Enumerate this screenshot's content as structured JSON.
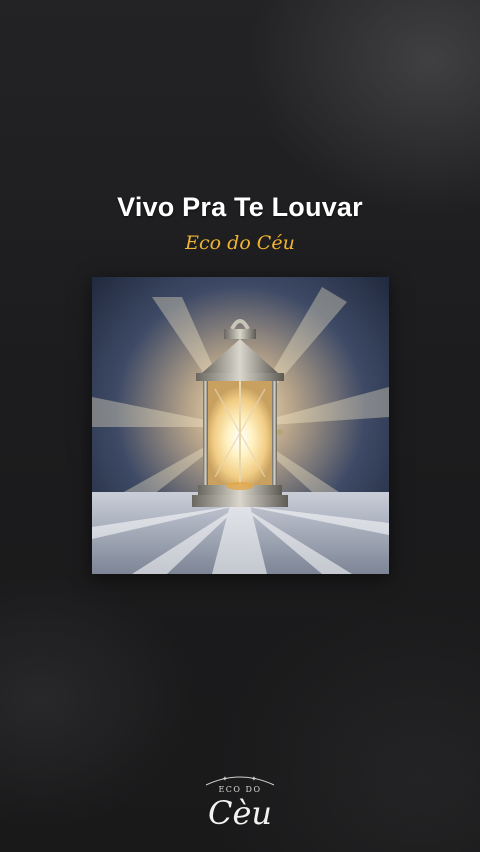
{
  "song": {
    "title": "Vivo Pra Te Louvar",
    "artist": "Eco do Céu"
  },
  "cover": {
    "image": "lantern-glowing-on-marble"
  },
  "logo": {
    "small_text": "ECO DO",
    "big_text": "Cèu"
  },
  "colors": {
    "background": "#1c1c1e",
    "title": "#ffffff",
    "artist": "#f0b431"
  }
}
